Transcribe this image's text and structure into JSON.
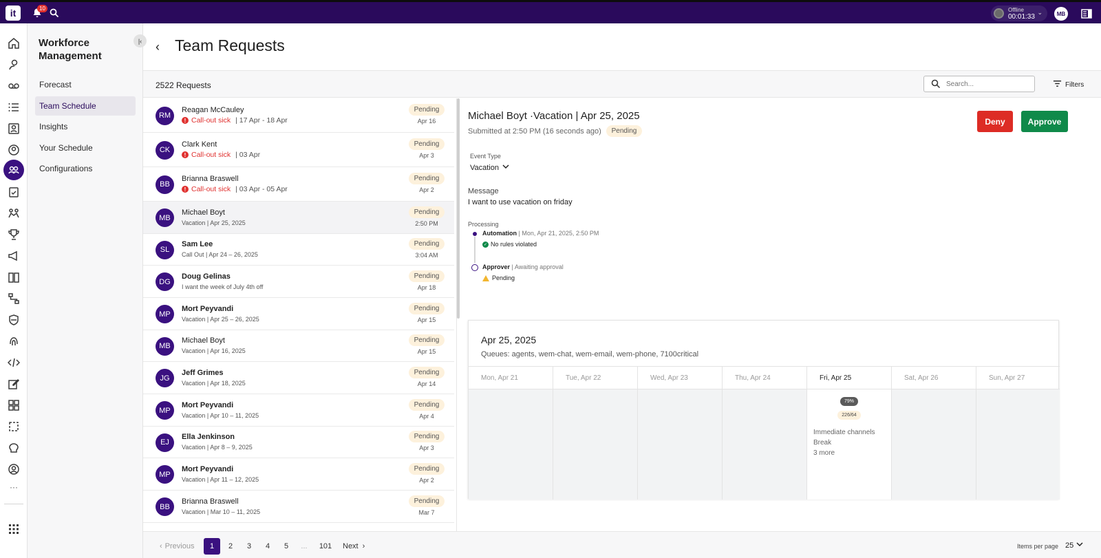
{
  "app": {
    "logo": "it",
    "notification_count": "10",
    "status": {
      "label": "Offline",
      "timer": "00:01:33"
    },
    "user_initials": "MB"
  },
  "sidenav": {
    "title": "Workforce Management",
    "items": [
      {
        "label": "Forecast"
      },
      {
        "label": "Team Schedule"
      },
      {
        "label": "Insights"
      },
      {
        "label": "Your Schedule"
      },
      {
        "label": "Configurations"
      }
    ]
  },
  "header": {
    "title": "Team Requests"
  },
  "subbar": {
    "count": "2522 Requests",
    "search_placeholder": "Search...",
    "filters_label": "Filters"
  },
  "requests": [
    {
      "initials": "RM",
      "name": "Reagan McCauley",
      "bold": false,
      "sick": true,
      "type": "Call-out sick",
      "detail": " | 17 Apr - 18 Apr",
      "status": "Pending",
      "date": "Apr 16"
    },
    {
      "initials": "CK",
      "name": "Clark Kent",
      "bold": false,
      "sick": true,
      "type": "Call-out sick",
      "detail": " | 03 Apr",
      "status": "Pending",
      "date": "Apr 3"
    },
    {
      "initials": "BB",
      "name": "Brianna Braswell",
      "bold": false,
      "sick": true,
      "type": "Call-out sick",
      "detail": " | 03 Apr - 05 Apr",
      "status": "Pending",
      "date": "Apr 2"
    },
    {
      "initials": "MB",
      "name": "Michael Boyt",
      "bold": false,
      "sick": false,
      "sub": "Vacation | Apr 25, 2025",
      "status": "Pending",
      "date": "2:50 PM"
    },
    {
      "initials": "SL",
      "name": "Sam Lee",
      "bold": true,
      "sick": false,
      "sub": "Call Out | Apr 24 – 26, 2025",
      "status": "Pending",
      "date": "3:04 AM"
    },
    {
      "initials": "DG",
      "name": "Doug Gelinas",
      "bold": true,
      "sick": false,
      "sub": "I want the week of July 4th off",
      "status": "Pending",
      "date": "Apr 18"
    },
    {
      "initials": "MP",
      "name": "Mort Peyvandi",
      "bold": true,
      "sick": false,
      "sub": "Vacation | Apr 25 – 26, 2025",
      "status": "Pending",
      "date": "Apr 15"
    },
    {
      "initials": "MB",
      "name": "Michael Boyt",
      "bold": false,
      "sick": false,
      "sub": "Vacation | Apr 16, 2025",
      "status": "Pending",
      "date": "Apr 15"
    },
    {
      "initials": "JG",
      "name": "Jeff Grimes",
      "bold": true,
      "sick": false,
      "sub": "Vacation | Apr 18, 2025",
      "status": "Pending",
      "date": "Apr 14"
    },
    {
      "initials": "MP",
      "name": "Mort Peyvandi",
      "bold": true,
      "sick": false,
      "sub": "Vacation | Apr 10 – 11, 2025",
      "status": "Pending",
      "date": "Apr 4"
    },
    {
      "initials": "EJ",
      "name": "Ella Jenkinson",
      "bold": true,
      "sick": false,
      "sub": "Vacation | Apr 8 – 9, 2025",
      "status": "Pending",
      "date": "Apr 3"
    },
    {
      "initials": "MP",
      "name": "Mort Peyvandi",
      "bold": true,
      "sick": false,
      "sub": "Vacation | Apr 11 – 12, 2025",
      "status": "Pending",
      "date": "Apr 2"
    },
    {
      "initials": "BB",
      "name": "Brianna Braswell",
      "bold": false,
      "sick": false,
      "sub": "Vacation | Mar 10 – 11, 2025",
      "status": "Pending",
      "date": "Mar 7"
    }
  ],
  "pagination": {
    "previous": "Previous",
    "pages": [
      "1",
      "2",
      "3",
      "4",
      "5",
      "...",
      "101"
    ],
    "next": "Next",
    "items_per_page_label": "Items per page",
    "items_per_page": "25"
  },
  "detail": {
    "title": "Michael Boyt ·Vacation | Apr 25, 2025",
    "submitted": "Submitted at 2:50 PM (16 seconds ago)",
    "status": "Pending",
    "deny_label": "Deny",
    "approve_label": "Approve",
    "event_type_label": "Event Type",
    "event_type": "Vacation",
    "message_label": "Message",
    "message": "I want to use vacation on friday",
    "processing_label": "Processing",
    "automation": {
      "label": "Automation",
      "time": "Mon, Apr 21, 2025, 2:50 PM",
      "result": "No rules violated"
    },
    "approver": {
      "label": "Approver",
      "state": "Awaiting approval",
      "result": "Pending"
    }
  },
  "calendar": {
    "date": "Apr 25, 2025",
    "queues": "Queues: agents, wem-chat, wem-email, wem-phone, 7100critical",
    "days": [
      "Mon, Apr 21",
      "Tue, Apr 22",
      "Wed, Apr 23",
      "Thu, Apr 24",
      "Fri, Apr 25",
      "Sat, Apr 26",
      "Sun, Apr 27"
    ],
    "today_index": 4,
    "today_pct": "79%",
    "today_ratio": "226/64",
    "today_events": [
      "Immediate channels",
      "Break",
      "3 more"
    ]
  }
}
